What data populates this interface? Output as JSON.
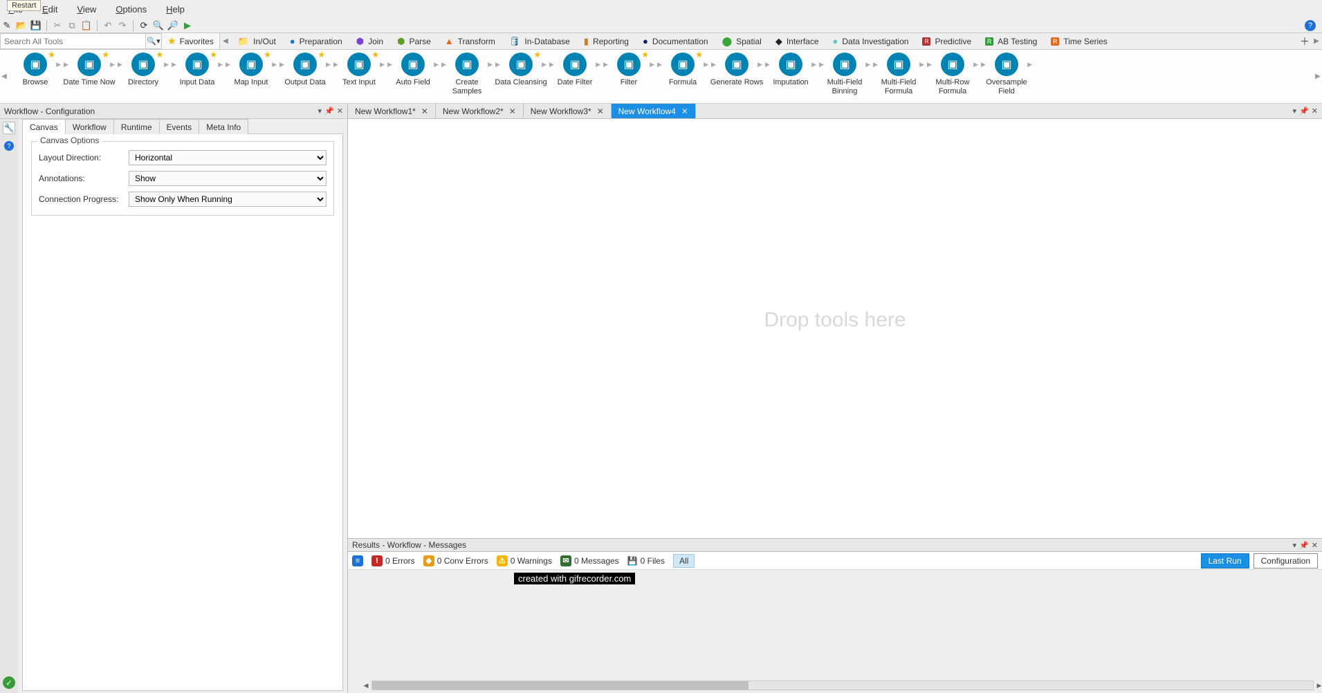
{
  "tooltip": {
    "restart": "Restart"
  },
  "menu": {
    "file": "File",
    "edit": "Edit",
    "view": "View",
    "options": "Options",
    "help": "Help"
  },
  "search": {
    "placeholder": "Search All Tools"
  },
  "favorites_label": "Favorites",
  "categories": [
    {
      "label": "In/Out",
      "color": "#1f9d55",
      "kind": "folder"
    },
    {
      "label": "Preparation",
      "color": "#1e6fd6",
      "kind": "circle"
    },
    {
      "label": "Join",
      "color": "#7b3fd1",
      "kind": "hex"
    },
    {
      "label": "Parse",
      "color": "#5aa022",
      "kind": "hex"
    },
    {
      "label": "Transform",
      "color": "#e06a1b",
      "kind": "tri-up"
    },
    {
      "label": "In-Database",
      "color": "#0a6b8a",
      "kind": "db"
    },
    {
      "label": "Reporting",
      "color": "#d8791a",
      "kind": "doc"
    },
    {
      "label": "Documentation",
      "color": "#0c1f6b",
      "kind": "circle"
    },
    {
      "label": "Spatial",
      "color": "#3aa63a",
      "kind": "pin"
    },
    {
      "label": "Interface",
      "color": "#222222",
      "kind": "diamond"
    },
    {
      "label": "Data Investigation",
      "color": "#61c7c7",
      "kind": "circle"
    },
    {
      "label": "Predictive",
      "color": "#b53131",
      "kind": "square-R"
    },
    {
      "label": "AB Testing",
      "color": "#2e9e3a",
      "kind": "square-R"
    },
    {
      "label": "Time Series",
      "color": "#e06a1b",
      "kind": "square-R"
    }
  ],
  "tools": [
    {
      "label": "Browse",
      "fav": true
    },
    {
      "label": "Date Time Now",
      "fav": true
    },
    {
      "label": "Directory",
      "fav": true
    },
    {
      "label": "Input Data",
      "fav": true
    },
    {
      "label": "Map Input",
      "fav": true
    },
    {
      "label": "Output Data",
      "fav": true
    },
    {
      "label": "Text Input",
      "fav": true
    },
    {
      "label": "Auto Field",
      "fav": false
    },
    {
      "label": "Create Samples",
      "fav": false
    },
    {
      "label": "Data Cleansing",
      "fav": true
    },
    {
      "label": "Date Filter",
      "fav": false
    },
    {
      "label": "Filter",
      "fav": true
    },
    {
      "label": "Formula",
      "fav": true
    },
    {
      "label": "Generate Rows",
      "fav": false
    },
    {
      "label": "Imputation",
      "fav": false
    },
    {
      "label": "Multi-Field Binning",
      "fav": false
    },
    {
      "label": "Multi-Field Formula",
      "fav": false
    },
    {
      "label": "Multi-Row Formula",
      "fav": false
    },
    {
      "label": "Oversample Field",
      "fav": false
    }
  ],
  "config": {
    "title": "Workflow - Configuration",
    "tabs": {
      "canvas": "Canvas",
      "workflow": "Workflow",
      "runtime": "Runtime",
      "events": "Events",
      "meta": "Meta Info"
    },
    "group_title": "Canvas Options",
    "layout_label": "Layout Direction:",
    "layout_value": "Horizontal",
    "annotations_label": "Annotations:",
    "annotations_value": "Show",
    "progress_label": "Connection Progress:",
    "progress_value": "Show Only When Running"
  },
  "workflow_tabs": [
    {
      "label": "New Workflow1*",
      "active": false
    },
    {
      "label": "New Workflow2*",
      "active": false
    },
    {
      "label": "New Workflow3*",
      "active": false
    },
    {
      "label": "New Workflow4",
      "active": true
    }
  ],
  "canvas_hint": "Drop tools here",
  "results": {
    "title": "Results - Workflow - Messages",
    "errors": "0 Errors",
    "conv": "0 Conv Errors",
    "warnings": "0 Warnings",
    "messages": "0 Messages",
    "files": "0 Files",
    "all": "All",
    "lastrun": "Last Run",
    "configuration": "Configuration"
  },
  "watermark": "created with gifrecorder.com"
}
